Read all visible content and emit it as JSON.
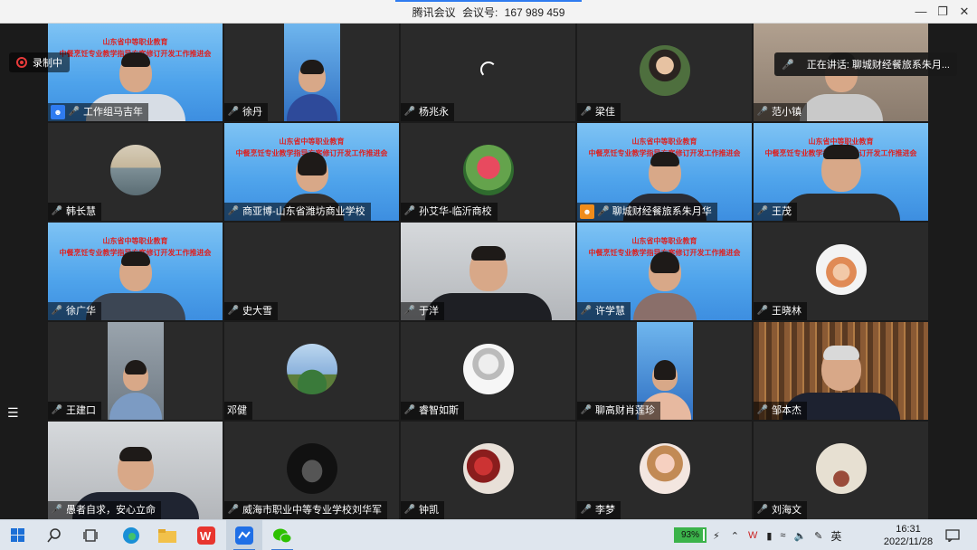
{
  "window": {
    "app_name": "腾讯会议",
    "meeting_label": "会议号:",
    "meeting_id": "167 989 459",
    "controls": {
      "minimize": "—",
      "restore": "❐",
      "close": "✕"
    }
  },
  "recording": {
    "label": "录制中"
  },
  "speaking": {
    "label": "正在讲话: 聊城财经餐旅系朱月..."
  },
  "banner": {
    "line1": "山东省中等职业教育",
    "line2": "中餐烹饪专业教学指导方案修订开发工作推进会"
  },
  "participants": [
    {
      "name": "工作组马吉年",
      "mic": "host-blue"
    },
    {
      "name": "徐丹",
      "mic": "off"
    },
    {
      "name": "杨兆永",
      "mic": "off"
    },
    {
      "name": "梁佳",
      "mic": "off"
    },
    {
      "name": "范小镇",
      "mic": "off"
    },
    {
      "name": "韩长慧",
      "mic": "off"
    },
    {
      "name": "商亚博-山东省潍坊商业学校",
      "mic": "off"
    },
    {
      "name": "孙艾华-临沂商校",
      "mic": "off"
    },
    {
      "name": "聊城财经餐旅系朱月华",
      "mic": "host-orange"
    },
    {
      "name": "王茂",
      "mic": "off"
    },
    {
      "name": "徐广华",
      "mic": "on"
    },
    {
      "name": "史大雪",
      "mic": "off"
    },
    {
      "name": "于洋",
      "mic": "off"
    },
    {
      "name": "许学慧",
      "mic": "off"
    },
    {
      "name": "王晓林",
      "mic": "off"
    },
    {
      "name": "王建口",
      "mic": "off"
    },
    {
      "name": "邓健",
      "mic": "none"
    },
    {
      "name": "睿智如斯",
      "mic": "off"
    },
    {
      "name": "聊高财肖莲珍",
      "mic": "off"
    },
    {
      "name": "邹本杰",
      "mic": "on"
    },
    {
      "name": "愚者自求，安心立命",
      "mic": "off"
    },
    {
      "name": "威海市职业中等专业学校刘华军",
      "mic": "off"
    },
    {
      "name": "钟凯",
      "mic": "off"
    },
    {
      "name": "李梦",
      "mic": "off"
    },
    {
      "name": "刘海文",
      "mic": "off"
    }
  ],
  "taskbar": {
    "battery_percent": "93%",
    "battery_level": 0.93,
    "ime": "英",
    "time": "16:31",
    "date": "2022/11/28"
  }
}
